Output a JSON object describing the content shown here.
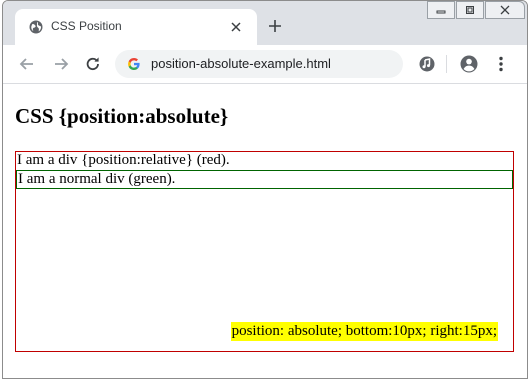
{
  "browser": {
    "tab": {
      "title": "CSS Position",
      "favicon": "globe-icon",
      "close_icon": "close-icon"
    },
    "new_tab_icon": "plus-icon",
    "window_controls": [
      "minimize-icon",
      "restore-icon",
      "close-icon"
    ],
    "address": {
      "url": "position-absolute-example.html",
      "site_icon": "google-g-icon"
    },
    "toolbar_icons": [
      "back-arrow-icon",
      "forward-arrow-icon",
      "reload-icon",
      "media-control-icon",
      "account-icon",
      "menu-kebab-icon"
    ]
  },
  "page": {
    "heading": "CSS {position:absolute}",
    "relative_div_text": "I am a div {position:relative} (red).",
    "normal_div_text": "I am a normal div (green).",
    "absolute_div_text": "position: absolute; bottom:10px; right:15px;"
  },
  "colors": {
    "relative_border": "#c00000",
    "normal_border": "#006400",
    "absolute_background": "#ffff00",
    "tabstrip_background": "#dee1e6"
  }
}
